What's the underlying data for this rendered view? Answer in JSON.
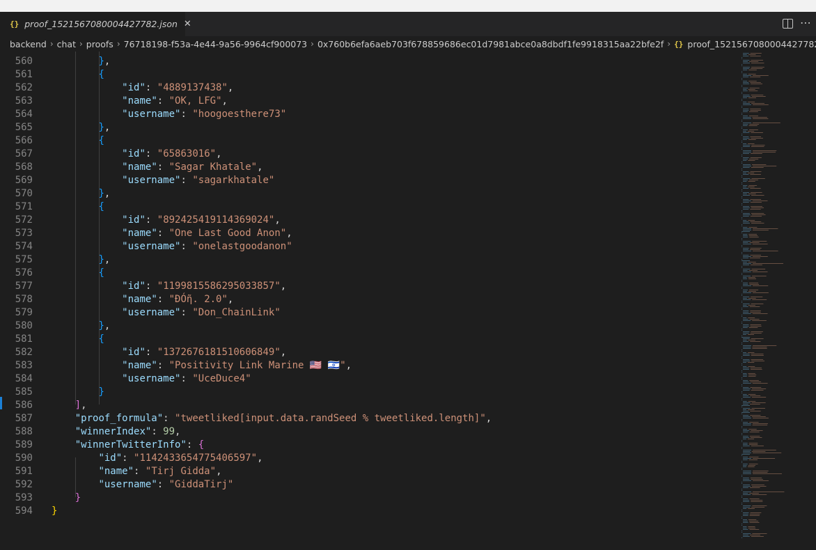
{
  "tab": {
    "icon": "json-braces-icon",
    "filename": "proof_1521567080004427782.json",
    "close": "✕"
  },
  "breadcrumbs": {
    "items": [
      "backend",
      "chat",
      "proofs",
      "76718198-f53a-4e44-9a56-9964cf900073",
      "0x760b6efa6aeb703f678859686ec01d7981abce0a8dbdf1fe9918315aa22bfe2f"
    ],
    "file_icon": "json-braces-icon",
    "file": "proof_1521567080004427782.json",
    "trailing": "…"
  },
  "editor": {
    "line_numbers": [
      "560",
      "561",
      "562",
      "563",
      "564",
      "565",
      "566",
      "567",
      "568",
      "569",
      "570",
      "571",
      "572",
      "573",
      "574",
      "575",
      "576",
      "577",
      "578",
      "579",
      "580",
      "581",
      "582",
      "583",
      "584",
      "585",
      "586",
      "587",
      "588",
      "589",
      "590",
      "591",
      "592",
      "593",
      "594"
    ],
    "entries": [
      {
        "id": "4889137438",
        "name": "OK, LFG",
        "username": "hoogoesthere73"
      },
      {
        "id": "65863016",
        "name": "Sagar Khatale",
        "username": "sagarkhatale"
      },
      {
        "id": "892425419114369024",
        "name": "One Last Good Anon",
        "username": "onelastgoodanon"
      },
      {
        "id": "1199815586295033857",
        "name": "ÐÓῆ. 2.0",
        "username": "Don_ChainLink"
      },
      {
        "id": "1372676181510606849",
        "name": "Positivity Link Marine 🇺🇸 🇮🇱",
        "username": "UceDuce4"
      }
    ],
    "keys": {
      "id": "id",
      "name": "name",
      "username": "username",
      "proof_formula": "proof_formula",
      "winnerIndex": "winnerIndex",
      "winnerTwitterInfo": "winnerTwitterInfo"
    },
    "proof_formula": "tweetliked[input.data.randSeed % tweetliked.length]",
    "winnerIndex": "99",
    "winner": {
      "id": "1142433654775406597",
      "name": "Tirj Gidda",
      "username": "GiddaTirj"
    }
  }
}
